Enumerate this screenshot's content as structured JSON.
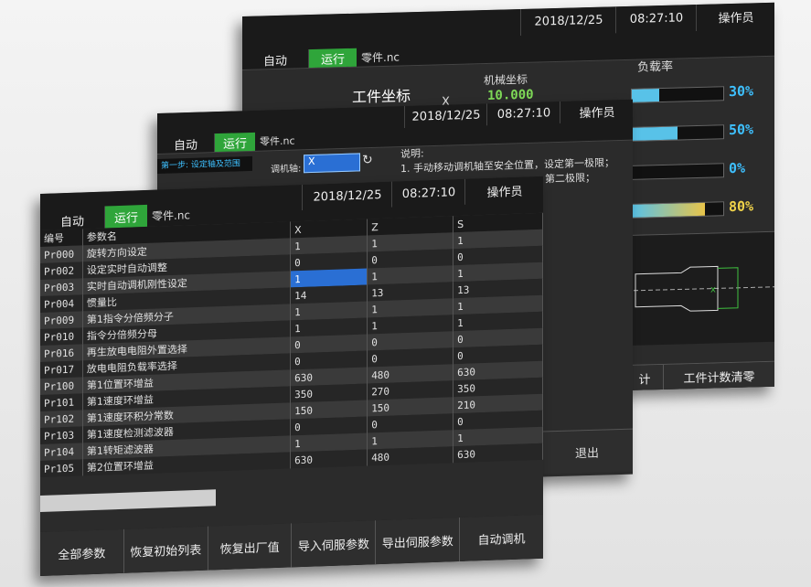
{
  "back": {
    "mode_auto": "自动",
    "mode_run": "运行",
    "file": "零件.nc",
    "date": "2018/12/25",
    "time": "08:27:10",
    "operator": "操作员",
    "work_coord": "工件坐标",
    "machine_coord": "机械坐标",
    "axis_x": "X",
    "machine_x": "10.000",
    "load_title": "负载率",
    "loads": [
      {
        "value": "30%",
        "fraction": 0.3,
        "color": "#58c2e8"
      },
      {
        "value": "50%",
        "fraction": 0.5,
        "color": "#58c2e8"
      },
      {
        "value": "0%",
        "fraction": 0.0,
        "color": "#58c2e8"
      },
      {
        "value": "80%",
        "fraction": 0.8,
        "color": "#e8c44a"
      }
    ],
    "btn_count": "计",
    "btn_clear": "工件计数清零"
  },
  "mid": {
    "mode_auto": "自动",
    "mode_run": "运行",
    "file": "零件.nc",
    "date": "2018/12/25",
    "time": "08:27:10",
    "operator": "操作员",
    "step": "第一步: 设定轴及范围",
    "axis_label": "调机轴:",
    "axis_value": "X",
    "note_title": "说明:",
    "note_1": "1. 手动移动调机轴至安全位置，设定第一极限；",
    "note_2": "第二极限；",
    "exit": "退出"
  },
  "front": {
    "mode_auto": "自动",
    "mode_run": "运行",
    "file": "零件.nc",
    "date": "2018/12/25",
    "time": "08:27:10",
    "operator": "操作员",
    "headers": [
      "编号",
      "参数名",
      "X",
      "Z",
      "S"
    ],
    "rows": [
      [
        "Pr000",
        "旋转方向设定",
        "1",
        "1",
        "1"
      ],
      [
        "Pr002",
        "设定实时自动调整",
        "0",
        "0",
        "0"
      ],
      [
        "Pr003",
        "实时自动调机刚性设定",
        "1",
        "1",
        "1"
      ],
      [
        "Pr004",
        "惯量比",
        "14",
        "13",
        "13"
      ],
      [
        "Pr009",
        "第1指令分倍频分子",
        "1",
        "1",
        "1"
      ],
      [
        "Pr010",
        "指令分倍频分母",
        "1",
        "1",
        "1"
      ],
      [
        "Pr016",
        "再生放电电阻外置选择",
        "0",
        "0",
        "0"
      ],
      [
        "Pr017",
        "放电电阻负载率选择",
        "0",
        "0",
        "0"
      ],
      [
        "Pr100",
        "第1位置环增益",
        "630",
        "480",
        "630"
      ],
      [
        "Pr101",
        "第1速度环增益",
        "350",
        "270",
        "350"
      ],
      [
        "Pr102",
        "第1速度环积分常数",
        "150",
        "150",
        "210"
      ],
      [
        "Pr103",
        "第1速度检测滤波器",
        "0",
        "0",
        "0"
      ],
      [
        "Pr104",
        "第1转矩滤波器",
        "1",
        "1",
        "1"
      ],
      [
        "Pr105",
        "第2位置环增益",
        "630",
        "480",
        "630"
      ]
    ],
    "buttons": [
      "全部参数",
      "恢复初始列表",
      "恢复出厂值",
      "导入伺服参数",
      "导出伺服参数",
      "自动调机"
    ]
  }
}
